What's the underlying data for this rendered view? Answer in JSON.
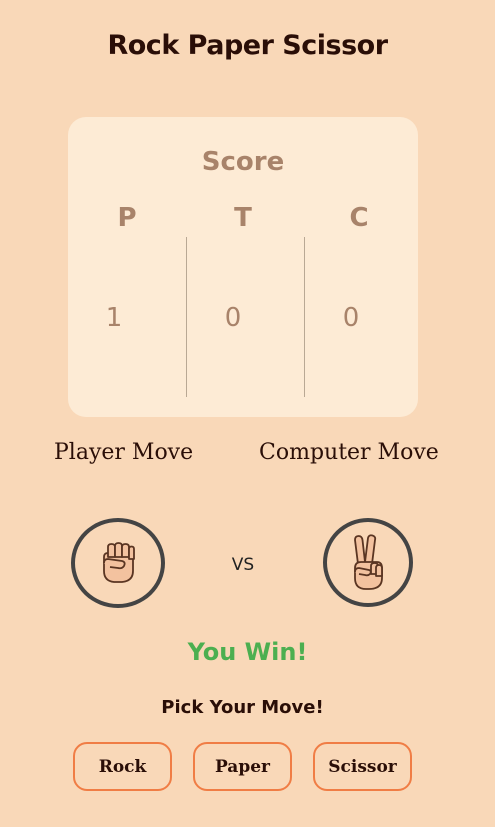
{
  "title": "Rock Paper Scissor",
  "score": {
    "heading": "Score",
    "columns": [
      {
        "label": "P",
        "value": "1"
      },
      {
        "label": "T",
        "value": "0"
      },
      {
        "label": "C",
        "value": "0"
      }
    ]
  },
  "moves": {
    "player_label": "Player Move",
    "computer_label": "Computer Move",
    "player_icon": "fist-icon",
    "computer_icon": "victory-hand-icon",
    "vs_label": "VS"
  },
  "result": {
    "text": "You Win!",
    "color": "#4caf50"
  },
  "controls": {
    "prompt": "Pick Your Move!",
    "buttons": [
      "Rock",
      "Paper",
      "Scissor"
    ],
    "accent_color": "#f07d45"
  }
}
